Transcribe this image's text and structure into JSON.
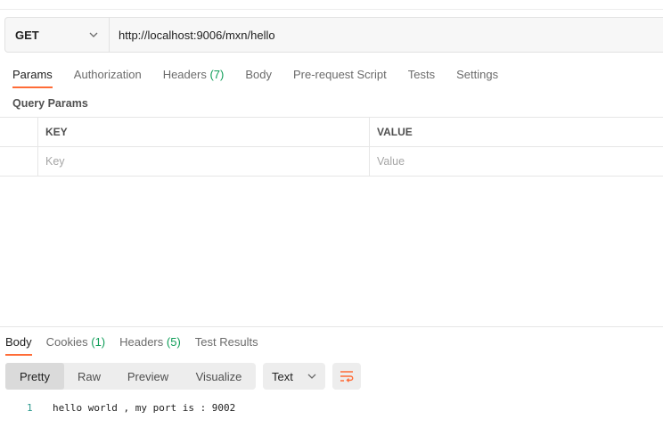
{
  "request": {
    "method": "GET",
    "url": "http://localhost:9006/mxn/hello"
  },
  "request_tabs": [
    {
      "label": "Params",
      "count": ""
    },
    {
      "label": "Authorization",
      "count": ""
    },
    {
      "label": "Headers",
      "count": "(7)"
    },
    {
      "label": "Body",
      "count": ""
    },
    {
      "label": "Pre-request Script",
      "count": ""
    },
    {
      "label": "Tests",
      "count": ""
    },
    {
      "label": "Settings",
      "count": ""
    }
  ],
  "query_params": {
    "title": "Query Params",
    "col_key": "KEY",
    "col_value": "VALUE",
    "key_placeholder": "Key",
    "value_placeholder": "Value"
  },
  "response_tabs": [
    {
      "label": "Body",
      "count": ""
    },
    {
      "label": "Cookies",
      "count": "(1)"
    },
    {
      "label": "Headers",
      "count": "(5)"
    },
    {
      "label": "Test Results",
      "count": ""
    }
  ],
  "view_modes": [
    "Pretty",
    "Raw",
    "Preview",
    "Visualize"
  ],
  "format": "Text",
  "response_body": {
    "line_number": "1",
    "text": "hello world , my port is : 9002"
  },
  "colors": {
    "accent": "#ff6c37",
    "count_green": "#0f9d58"
  }
}
